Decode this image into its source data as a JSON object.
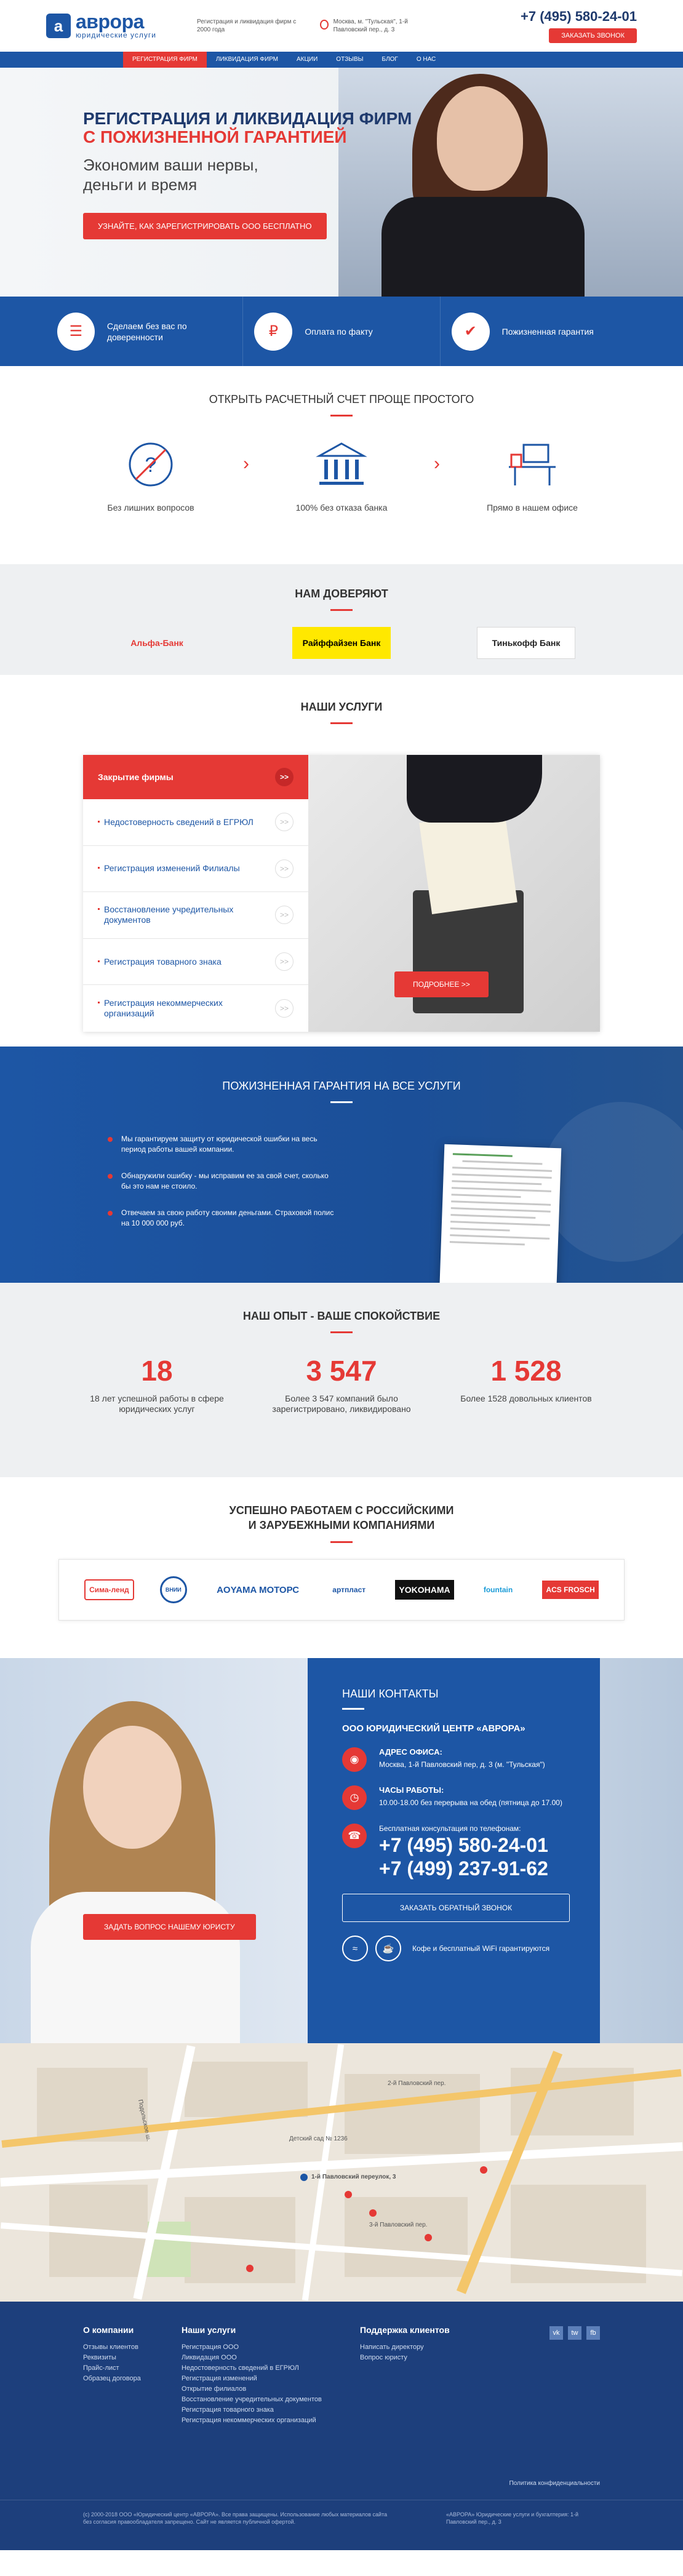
{
  "header": {
    "logo_name": "аврора",
    "logo_sub": "юридические услуги",
    "tagline": "Регистрация и ликвидация фирм с 2000 года",
    "address": "Москва, м. \"Тульская\", 1-й Павловский пер., д. 3",
    "phone": "+7 (495) 580-24-01",
    "call_btn": "Заказать звонок"
  },
  "nav": {
    "items": [
      {
        "label": "Регистрация фирм"
      },
      {
        "label": "Ликвидация фирм"
      },
      {
        "label": "Акции"
      },
      {
        "label": "Отзывы"
      },
      {
        "label": "Блог"
      },
      {
        "label": "О нас"
      }
    ]
  },
  "hero": {
    "title": "Регистрация и ликвидация фирм",
    "title2": "с пожизненной гарантией",
    "subtitle": "Экономим ваши нервы, деньги и время",
    "cta": "Узнайте, как зарегистрировать ООО бесплатно"
  },
  "advantages": [
    {
      "icon": "document-icon",
      "text": "Сделаем без вас по доверенности"
    },
    {
      "icon": "wallet-icon",
      "text": "Оплата по факту"
    },
    {
      "icon": "shield-icon",
      "text": "Пожизненная гарантия"
    }
  ],
  "account": {
    "title": "Открыть расчетный счет проще простого",
    "items": [
      {
        "icon": "question-icon",
        "text": "Без лишних вопросов"
      },
      {
        "icon": "bank-icon",
        "text": "100% без отказа банка"
      },
      {
        "icon": "office-icon",
        "text": "Прямо в нашем офисе"
      }
    ]
  },
  "trust": {
    "title": "Нам доверяют",
    "banks": [
      "Альфа-Банк",
      "Райффайзен Банк",
      "Тинькофф Банк"
    ]
  },
  "services": {
    "title": "Наши услуги",
    "head": "Закрытие фирмы",
    "items": [
      "Недостоверность сведений в ЕГРЮЛ",
      "Регистрация изменений Филиалы",
      "Восстановление учредительных документов",
      "Регистрация товарного знака",
      "Регистрация некоммерческих организаций"
    ],
    "more": "Подробнее >>"
  },
  "guarantee": {
    "title": "Пожизненная гарантия на все услуги",
    "items": [
      "Мы гарантируем защиту от юридической ошибки на весь период работы вашей компании.",
      "Обнаружили ошибку - мы исправим ее за свой счет, сколько бы это нам не стоило.",
      "Отвечаем за свою работу своими деньгами. Страховой полис на 10 000 000 руб."
    ]
  },
  "experience": {
    "title": "Наш опыт - ваше спокойствие",
    "items": [
      {
        "num": "18",
        "text": "18 лет успешной работы в сфере юридических услуг"
      },
      {
        "num": "3 547",
        "text": "Более 3 547 компаний было зарегистрировано, ликвидировано"
      },
      {
        "num": "1 528",
        "text": "Более 1528 довольных клиентов"
      }
    ]
  },
  "partners": {
    "title_line1": "Успешно работаем с российскими",
    "title_line2": "и зарубежными компаниями",
    "logos": [
      "Сима-ленд",
      "ВНИИ",
      "AOYAMA МОТОРС",
      "артпласт",
      "YOKOHAMA",
      "fountain",
      "ACS FROSCH"
    ]
  },
  "contacts": {
    "ask_btn": "Задать вопрос нашему юристу",
    "title": "Наши контакты",
    "org": "ООО Юридический центр «Аврора»",
    "addr_label": "Адрес офиса:",
    "addr": "Москва, 1-й Павловский пер, д. 3 (м. \"Тульская\")",
    "hours_label": "Часы работы:",
    "hours": "10.00-18.00 без перерыва на обед (пятница до 17.00)",
    "phone_note": "Бесплатная консультация по телефонам:",
    "phone1": "+7 (495) 580-24-01",
    "phone2": "+7 (499) 237-91-62",
    "call_btn": "Заказать обратный звонок",
    "wifi_text": "Кофе и бесплатный WiFi гарантируются"
  },
  "map": {
    "label_main": "1-й Павловский переулок, 3",
    "labels": [
      "2-й Павловский пер.",
      "Подольское ш.",
      "Детский сад № 1236",
      "3-й Павловский пер."
    ]
  },
  "footer": {
    "col1": {
      "title": "О компании",
      "links": [
        "Отзывы клиентов",
        "Реквизиты",
        "Прайс-лист",
        "Образец договора"
      ]
    },
    "col2": {
      "title": "Наши услуги",
      "links": [
        "Регистрация ООО",
        "Ликвидация ООО",
        "Недостоверность сведений в ЕГРЮЛ",
        "Регистрация изменений",
        "Открытие филиалов",
        "Восстановление учредительных документов",
        "Регистрация товарного знака",
        "Регистрация некоммерческих организаций"
      ]
    },
    "col3": {
      "title": "Поддержка клиентов",
      "links": [
        "Написать директору",
        "Вопрос юристу"
      ]
    },
    "social": [
      "vk",
      "tw",
      "fb"
    ],
    "privacy": "Политика конфиденциальности",
    "copyright": "(с) 2000-2018 ООО «Юридический центр «АВРОРА». Все права защищены. Использование любых материалов сайта без согласия правообладателя запрещено. Сайт не является публичной офертой.",
    "copyright2": "«АВРОРА» Юридические услуги и бухгалтерия: 1-й Павловский пер., д. 3"
  },
  "colors": {
    "brand_blue": "#1d56a5",
    "accent_red": "#e53935",
    "footer_blue": "#1d3f7c"
  }
}
